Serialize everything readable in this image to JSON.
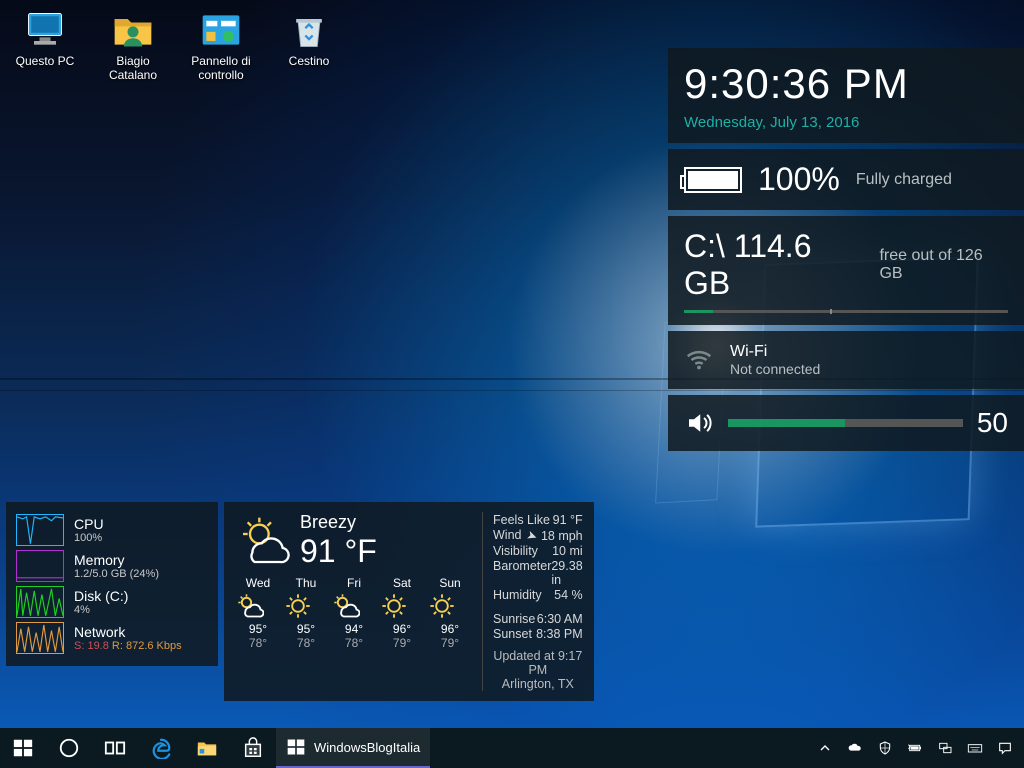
{
  "desktop_icons": [
    {
      "name": "Questo PC",
      "icon": "pc"
    },
    {
      "name": "Biagio Catalano",
      "icon": "user-folder"
    },
    {
      "name": "Pannello di controllo",
      "icon": "control-panel"
    },
    {
      "name": "Cestino",
      "icon": "recycle-bin"
    }
  ],
  "clock": {
    "time": "9:30:36 PM",
    "date": "Wednesday, July 13, 2016"
  },
  "battery": {
    "percent": "100%",
    "status": "Fully charged"
  },
  "disk": {
    "drive": "C:\\",
    "free": "114.6 GB",
    "suffix": "free out of 126 GB",
    "used_fraction": 0.09
  },
  "wifi": {
    "name": "Wi-Fi",
    "state": "Not connected"
  },
  "volume": {
    "value": "50",
    "fraction": 0.5
  },
  "sysmon": {
    "cpu": {
      "label": "CPU",
      "value": "100%"
    },
    "mem": {
      "label": "Memory",
      "value": "1.2/5.0 GB (24%)"
    },
    "disk": {
      "label": "Disk (C:)",
      "value": "4%"
    },
    "net": {
      "label": "Network",
      "send": "S: 19.8",
      "recv": "R: 872.6 Kbps"
    }
  },
  "weather": {
    "condition": "Breezy",
    "temp": "91 °F",
    "details": {
      "feels_like_label": "Feels Like",
      "feels_like": "91 °F",
      "wind_label": "Wind",
      "wind": "18 mph",
      "visibility_label": "Visibility",
      "visibility": "10 mi",
      "barometer_label": "Barometer",
      "barometer": "29.38 in",
      "humidity_label": "Humidity",
      "humidity": "54 %",
      "sunrise_label": "Sunrise",
      "sunrise": "6:30 AM",
      "sunset_label": "Sunset",
      "sunset": "8:38 PM"
    },
    "days": [
      {
        "d": "Wed",
        "hi": "95°",
        "lo": "78°",
        "icon": "partly"
      },
      {
        "d": "Thu",
        "hi": "95°",
        "lo": "78°",
        "icon": "sunny"
      },
      {
        "d": "Fri",
        "hi": "94°",
        "lo": "78°",
        "icon": "partly"
      },
      {
        "d": "Sat",
        "hi": "96°",
        "lo": "79°",
        "icon": "sunny"
      },
      {
        "d": "Sun",
        "hi": "96°",
        "lo": "79°",
        "icon": "sunny"
      }
    ],
    "updated": "Updated at 9:17 PM",
    "location": "Arlington, TX"
  },
  "taskbar": {
    "app_title": "WindowsBlogItalia"
  }
}
